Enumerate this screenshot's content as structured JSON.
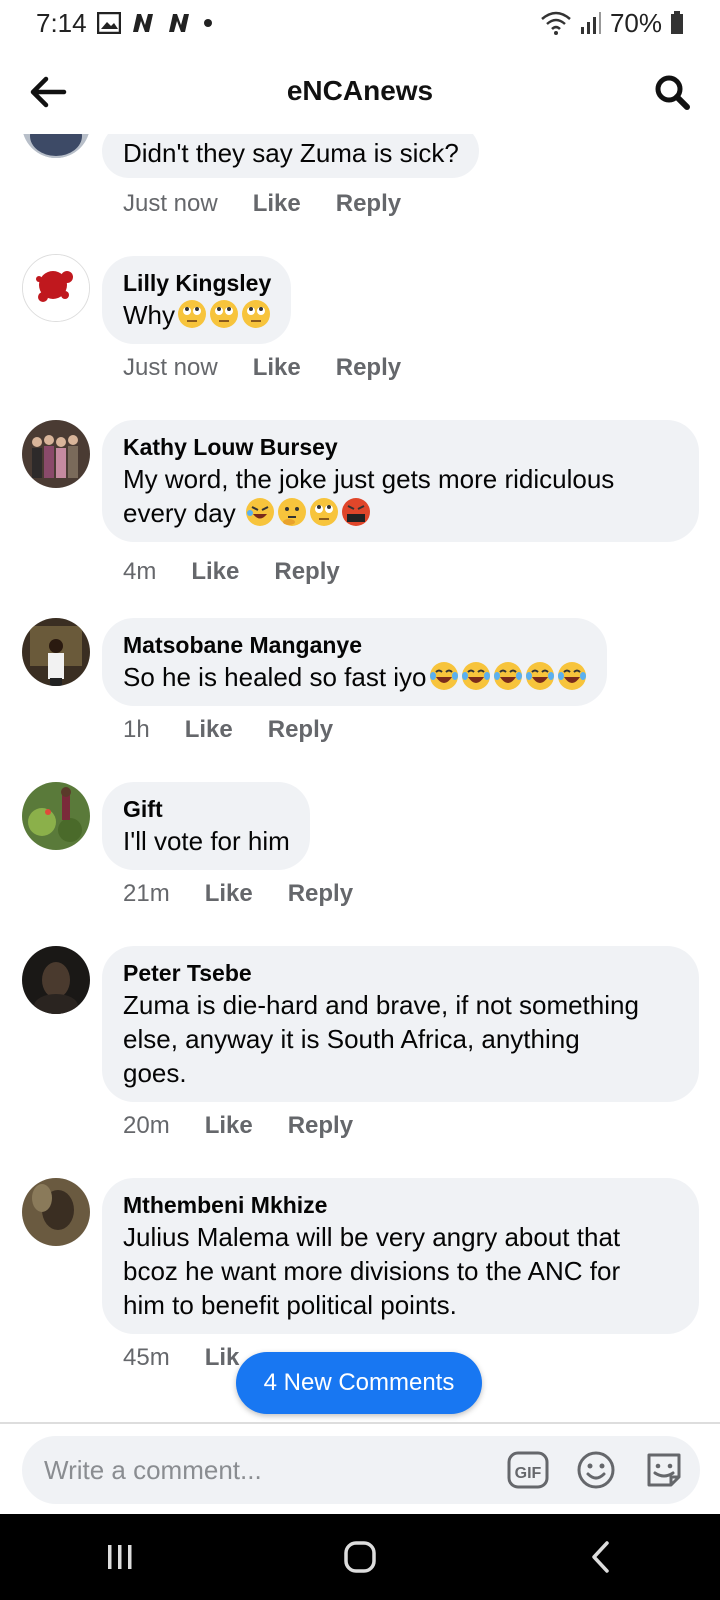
{
  "status_bar": {
    "time": "7:14",
    "battery": "70%"
  },
  "header": {
    "title": "eNCAnews"
  },
  "comments": [
    {
      "author": "",
      "text": "Didn't they say Zuma is sick?",
      "time": "Just now",
      "like": "Like",
      "reply": "Reply"
    },
    {
      "author": "Lilly Kingsley",
      "text": "Why",
      "emojis": [
        "eye-roll",
        "eye-roll",
        "eye-roll"
      ],
      "time": "Just now",
      "like": "Like",
      "reply": "Reply"
    },
    {
      "author": "Kathy Louw Bursey",
      "text_line1": "My word, the joke just gets more ridiculous",
      "text_line2": "every day",
      "emojis": [
        "rofl",
        "thinking",
        "eye-roll",
        "cursing"
      ],
      "time": "4m",
      "like": "Like",
      "reply": "Reply"
    },
    {
      "author": "Matsobane Manganye",
      "text": "So he is healed so fast iyo",
      "emojis": [
        "tears-of-joy",
        "tears-of-joy",
        "tears-of-joy",
        "tears-of-joy",
        "tears-of-joy"
      ],
      "time": "1h",
      "like": "Like",
      "reply": "Reply"
    },
    {
      "author": "Gift",
      "text": "I'll vote for him",
      "time": "21m",
      "like": "Like",
      "reply": "Reply"
    },
    {
      "author": "Peter Tsebe",
      "text_line1": "Zuma is die-hard and brave, if not something",
      "text_line2": "else, anyway it is South Africa, anything",
      "text_line3": "goes.",
      "time": "20m",
      "like": "Like",
      "reply": "Reply"
    },
    {
      "author": "Mthembeni Mkhize",
      "text_line1": "Julius Malema will be very angry about that",
      "text_line2": "bcoz he want more divisions to the ANC for",
      "text_line3": "him to benefit  political points.",
      "time": "45m",
      "like": "Lik"
    }
  ],
  "new_comments_pill": "4 New Comments",
  "composer": {
    "placeholder": "Write a comment..."
  },
  "colors": {
    "accent": "#1877f2",
    "bubble": "#f0f2f5",
    "meta": "#65676b"
  }
}
